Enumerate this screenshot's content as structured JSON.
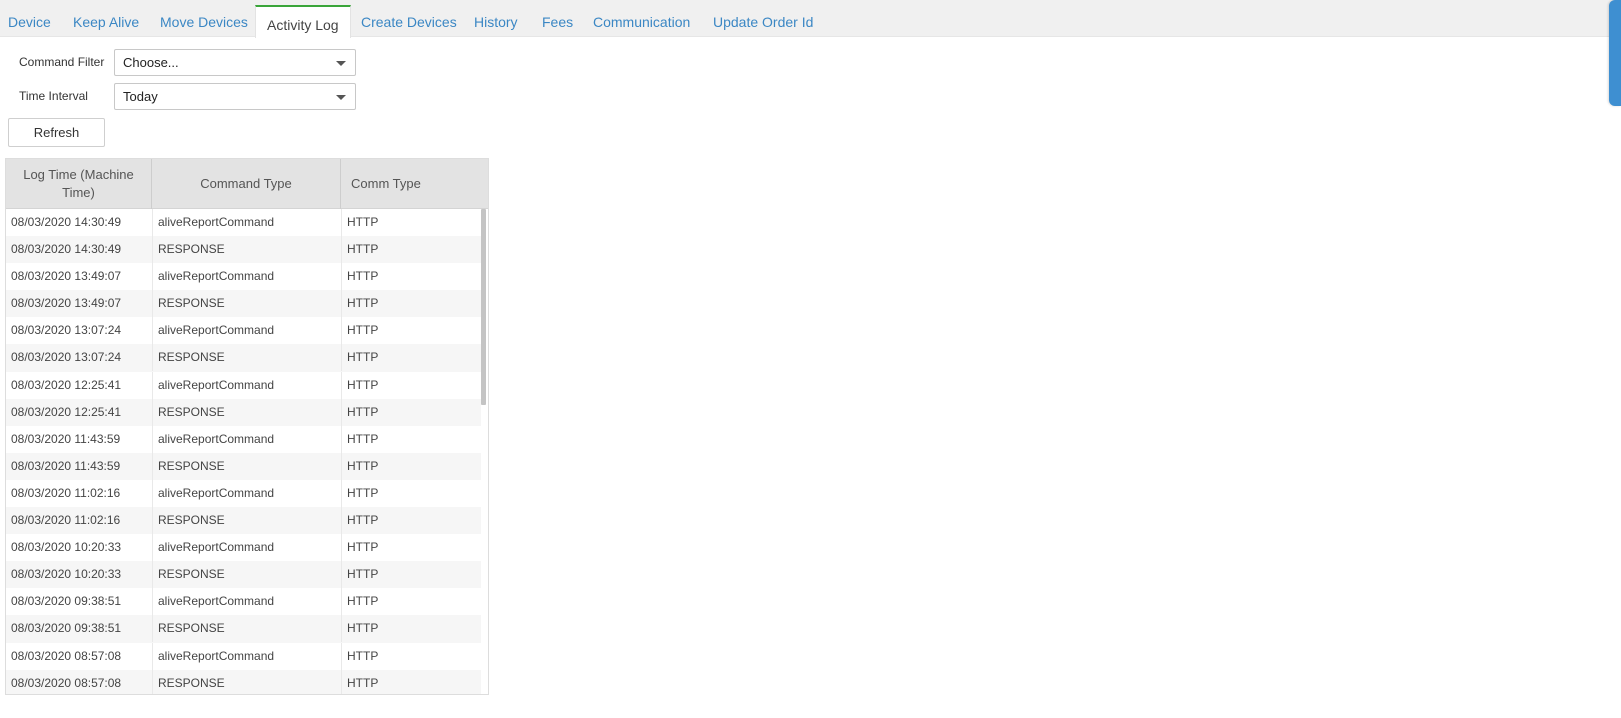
{
  "tabs": [
    {
      "label": "Device",
      "active": false
    },
    {
      "label": "Keep Alive",
      "active": false
    },
    {
      "label": "Move Devices",
      "active": false
    },
    {
      "label": "Activity Log",
      "active": true
    },
    {
      "label": "Create Devices",
      "active": false
    },
    {
      "label": "History",
      "active": false
    },
    {
      "label": "Fees",
      "active": false
    },
    {
      "label": "Communication",
      "active": false
    },
    {
      "label": "Update Order Id",
      "active": false
    }
  ],
  "filters": {
    "command_filter_label": "Command Filter",
    "command_filter_value": "Choose...",
    "time_interval_label": "Time Interval",
    "time_interval_value": "Today",
    "refresh_label": "Refresh"
  },
  "grid": {
    "columns": [
      "Log Time (Machine Time)",
      "Command Type",
      "Comm Type"
    ],
    "rows": [
      [
        "08/03/2020 14:30:49",
        "aliveReportCommand",
        "HTTP"
      ],
      [
        "08/03/2020 14:30:49",
        "RESPONSE",
        "HTTP"
      ],
      [
        "08/03/2020 13:49:07",
        "aliveReportCommand",
        "HTTP"
      ],
      [
        "08/03/2020 13:49:07",
        "RESPONSE",
        "HTTP"
      ],
      [
        "08/03/2020 13:07:24",
        "aliveReportCommand",
        "HTTP"
      ],
      [
        "08/03/2020 13:07:24",
        "RESPONSE",
        "HTTP"
      ],
      [
        "08/03/2020 12:25:41",
        "aliveReportCommand",
        "HTTP"
      ],
      [
        "08/03/2020 12:25:41",
        "RESPONSE",
        "HTTP"
      ],
      [
        "08/03/2020 11:43:59",
        "aliveReportCommand",
        "HTTP"
      ],
      [
        "08/03/2020 11:43:59",
        "RESPONSE",
        "HTTP"
      ],
      [
        "08/03/2020 11:02:16",
        "aliveReportCommand",
        "HTTP"
      ],
      [
        "08/03/2020 11:02:16",
        "RESPONSE",
        "HTTP"
      ],
      [
        "08/03/2020 10:20:33",
        "aliveReportCommand",
        "HTTP"
      ],
      [
        "08/03/2020 10:20:33",
        "RESPONSE",
        "HTTP"
      ],
      [
        "08/03/2020 09:38:51",
        "aliveReportCommand",
        "HTTP"
      ],
      [
        "08/03/2020 09:38:51",
        "RESPONSE",
        "HTTP"
      ],
      [
        "08/03/2020 08:57:08",
        "aliveReportCommand",
        "HTTP"
      ],
      [
        "08/03/2020 08:57:08",
        "RESPONSE",
        "HTTP"
      ]
    ]
  },
  "icons": {
    "select_caret": "chevron-down-icon"
  },
  "colors": {
    "tab_link": "#3b87c4",
    "active_tab_border": "#3aa53a",
    "side_handle": "#3e8fd1",
    "header_bg": "#e3e3e3"
  }
}
